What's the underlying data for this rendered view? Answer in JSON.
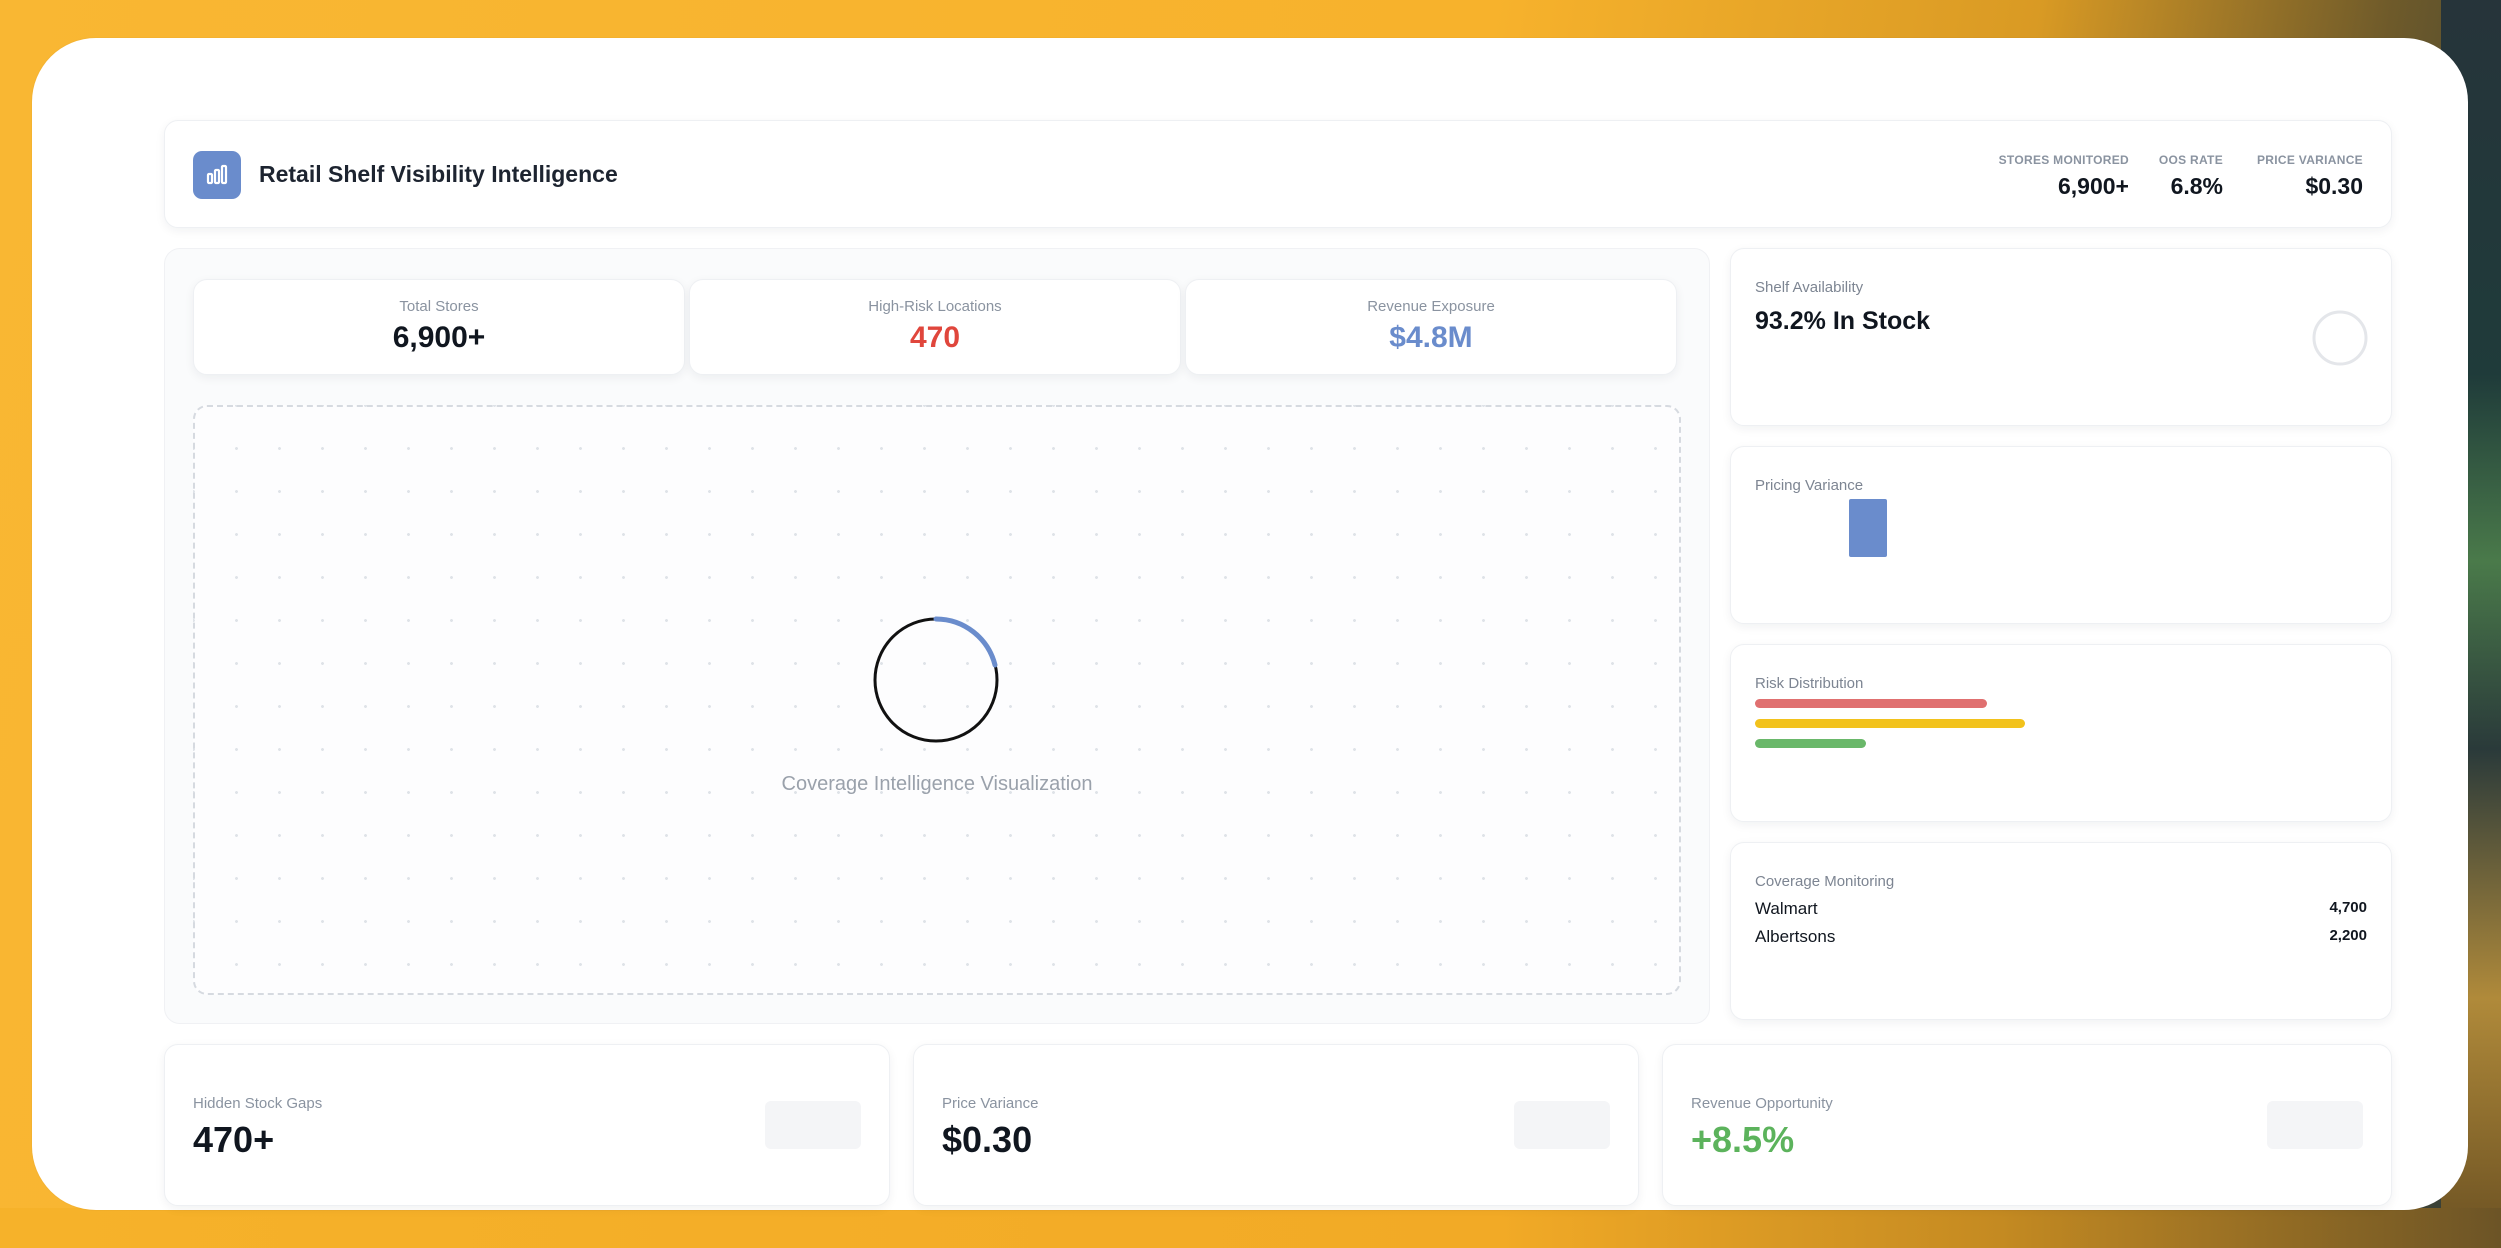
{
  "app": {
    "title": "Retail Shelf Visibility Intelligence",
    "brand_color": "#6a8ccc",
    "logo_icon": "bar-chart-icon"
  },
  "header_stats": [
    {
      "label": "STORES MONITORED",
      "value": "6,900+"
    },
    {
      "label": "OOS RATE",
      "value": "6.8%"
    },
    {
      "label": "PRICE VARIANCE",
      "value": "$0.30"
    }
  ],
  "kpis": [
    {
      "label": "Total Stores",
      "value": "6,900+",
      "color": "#10161f"
    },
    {
      "label": "High-Risk Locations",
      "value": "470",
      "color": "#e0463c"
    },
    {
      "label": "Revenue Exposure",
      "value": "$4.8M",
      "color": "#6a8ccc"
    }
  ],
  "visualization": {
    "label": "Coverage Intelligence Visualization",
    "spinner_icon": "loading-ring-icon"
  },
  "shelf_availability": {
    "label": "Shelf Availability",
    "value": "93.2% In Stock",
    "icon": "circle-ring-icon"
  },
  "pricing_variance": {
    "label": "Pricing Variance",
    "bar_color": "#6a8ccc"
  },
  "risk_distribution": {
    "label": "Risk Distribution",
    "bars": [
      {
        "level": 0.86,
        "color": "#e07070"
      },
      {
        "level": 1.0,
        "color": "#f2c21c"
      },
      {
        "level": 0.41,
        "color": "#6ab86a"
      }
    ]
  },
  "coverage_monitoring": {
    "label": "Coverage Monitoring",
    "rows": [
      {
        "name": "Walmart",
        "value": "4,700"
      },
      {
        "name": "Albertsons",
        "value": "2,200"
      }
    ]
  },
  "bottom_cards": [
    {
      "label": "Hidden Stock Gaps",
      "value": "470+",
      "color": "#10161f"
    },
    {
      "label": "Price Variance",
      "value": "$0.30",
      "color": "#10161f"
    },
    {
      "label": "Revenue Opportunity",
      "value": "+8.5%",
      "color": "#5cb35c"
    }
  ]
}
